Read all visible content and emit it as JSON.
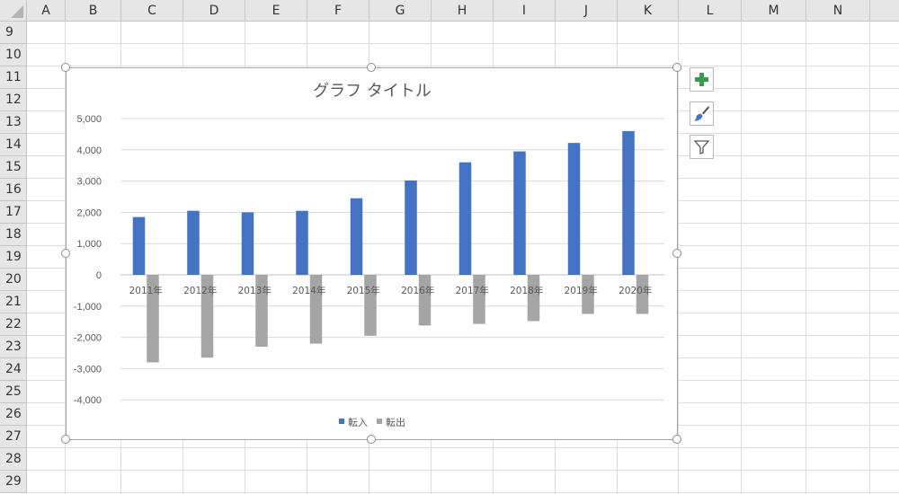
{
  "sheet": {
    "columns": [
      "A",
      "B",
      "C",
      "D",
      "E",
      "F",
      "G",
      "H",
      "I",
      "J",
      "K",
      "L",
      "M",
      "N"
    ],
    "rows": [
      "9",
      "10",
      "11",
      "12",
      "13",
      "14",
      "15",
      "16",
      "17",
      "18",
      "19",
      "20",
      "21",
      "22",
      "23",
      "24",
      "25",
      "26",
      "27",
      "28",
      "29"
    ]
  },
  "chart_buttons": {
    "elements": "chart-elements-plus-icon",
    "styles": "paintbrush-icon",
    "filters": "funnel-filter-icon"
  },
  "colors": {
    "series_in": "#4472c4",
    "series_out": "#a5a5a5",
    "gridline": "#d9d9d9",
    "sheet_header_bg": "#e6e6e6"
  },
  "chart_data": {
    "type": "bar",
    "title": "グラフ タイトル",
    "categories": [
      "2011年",
      "2012年",
      "2013年",
      "2014年",
      "2015年",
      "2016年",
      "2017年",
      "2018年",
      "2019年",
      "2020年"
    ],
    "series": [
      {
        "name": "転入",
        "values": [
          1850,
          2050,
          2000,
          2050,
          2450,
          3020,
          3600,
          3950,
          4220,
          4600
        ]
      },
      {
        "name": "転出",
        "values": [
          -2800,
          -2650,
          -2300,
          -2200,
          -1950,
          -1620,
          -1570,
          -1480,
          -1250,
          -1250
        ]
      }
    ],
    "yticks": [
      "5,000",
      "4,000",
      "3,000",
      "2,000",
      "1,000",
      "0",
      "-1,000",
      "-2,000",
      "-3,000",
      "-4,000"
    ],
    "ylim": [
      -4000,
      5000
    ],
    "grid": true,
    "legend_position": "bottom"
  }
}
